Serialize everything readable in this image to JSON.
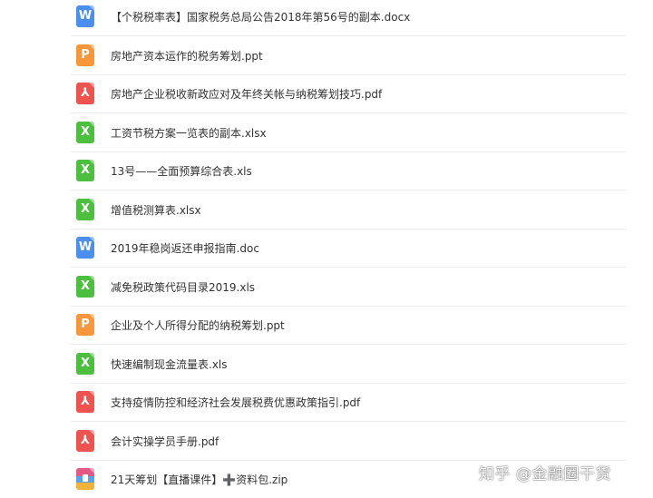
{
  "files": [
    {
      "type": "word",
      "letter": "W",
      "icon": "word-file-icon",
      "name": "【个税税率表】国家税务总局公告2018年第56号的副本.docx"
    },
    {
      "type": "ppt",
      "letter": "P",
      "icon": "ppt-file-icon",
      "name": "房地产资本运作的税务筹划.ppt"
    },
    {
      "type": "pdf",
      "letter": "⅄",
      "icon": "pdf-file-icon",
      "name": "房地产企业税收新政应对及年终关帐与纳税筹划技巧.pdf"
    },
    {
      "type": "xls",
      "letter": "X",
      "icon": "excel-file-icon",
      "name": "工资节税方案一览表的副本.xlsx"
    },
    {
      "type": "xls",
      "letter": "X",
      "icon": "excel-file-icon",
      "name": "13号——全面预算综合表.xls"
    },
    {
      "type": "xls",
      "letter": "X",
      "icon": "excel-file-icon",
      "name": "增值税测算表.xlsx"
    },
    {
      "type": "word",
      "letter": "W",
      "icon": "word-file-icon",
      "name": "2019年稳岗返还申报指南.doc"
    },
    {
      "type": "xls",
      "letter": "X",
      "icon": "excel-file-icon",
      "name": "减免税政策代码目录2019.xls"
    },
    {
      "type": "ppt",
      "letter": "P",
      "icon": "ppt-file-icon",
      "name": "企业及个人所得分配的纳税筹划.ppt"
    },
    {
      "type": "xls",
      "letter": "X",
      "icon": "excel-file-icon",
      "name": "快速编制现金流量表.xls"
    },
    {
      "type": "pdf",
      "letter": "⅄",
      "icon": "pdf-file-icon",
      "name": "支持疫情防控和经济社会发展税费优惠政策指引.pdf"
    },
    {
      "type": "pdf",
      "letter": "⅄",
      "icon": "pdf-file-icon",
      "name": "会计实操学员手册.pdf"
    },
    {
      "type": "zip",
      "letter": "",
      "icon": "zip-archive-icon",
      "name": "21天筹划【直播课件】➕资料包.zip"
    }
  ],
  "watermark": "知乎 @金融圈干货",
  "colors": {
    "word": "#4a8ef0",
    "ppt": "#f7963b",
    "pdf": "#ef5350",
    "xls": "#4cbf3e",
    "zip": "#f2b33d"
  }
}
